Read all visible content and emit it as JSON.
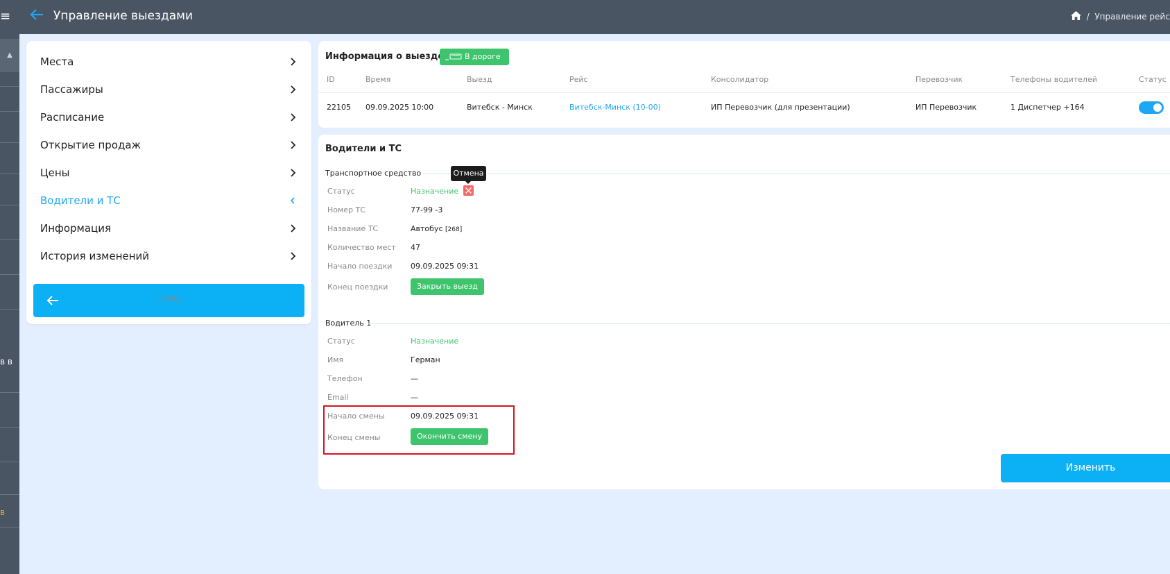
{
  "header": {
    "title": "Управление выездами",
    "breadcrumb": "Управление рейсами"
  },
  "rail": {
    "frag_1": "в в",
    "frag_2": "в"
  },
  "nav": {
    "items": [
      {
        "label": "Места"
      },
      {
        "label": "Пассажиры"
      },
      {
        "label": "Расписание"
      },
      {
        "label": "Открытие продаж"
      },
      {
        "label": "Цены"
      },
      {
        "label": "Водители и ТС",
        "active": true
      },
      {
        "label": "Информация"
      },
      {
        "label": "История изменений"
      }
    ],
    "back_label": "Назад"
  },
  "trip_info": {
    "title": "Информация о выезде",
    "status_badge": "В дороге",
    "columns": [
      "ID",
      "Время",
      "Выезд",
      "Рейс",
      "Консолидатор",
      "Перевозчик",
      "Телефоны водителей",
      "Статус"
    ],
    "row": {
      "id": "22105",
      "time": "09.09.2025 10:00",
      "departure": "Витебск - Минск",
      "route": "Витебск-Минск (10-00)",
      "consolidator": "ИП Перевозчик (для презентации)",
      "carrier": "ИП Перевозчик",
      "phones": "1 Диспетчер +164",
      "status_on": true
    }
  },
  "drivers": {
    "title": "Водители и ТС",
    "vehicle": {
      "section_title": "Транспортное средство",
      "tooltip": "Отмена",
      "labels": {
        "status": "Статус",
        "number": "Номер ТС",
        "name": "Название ТС",
        "seats": "Количество мест",
        "start": "Начало поездки",
        "end": "Конец поездки"
      },
      "values": {
        "status": "Назначение",
        "number": "77-99 -3",
        "name": "Автобус",
        "name_code": "[268]",
        "seats": "47",
        "start": "09.09.2025 09:31",
        "close_button": "Закрыть выезд"
      }
    },
    "driver1": {
      "section_title": "Водитель 1",
      "labels": {
        "status": "Статус",
        "name": "Имя",
        "phone": "Телефон",
        "email": "Email",
        "shift_start": "Начало смены",
        "shift_end": "Конец смены"
      },
      "values": {
        "status": "Назначение",
        "name": "Герман",
        "phone": "—",
        "email": "—",
        "shift_start": "09.09.2025 09:31",
        "end_shift_button": "Окончить смену"
      }
    },
    "edit_button": "Изменить"
  },
  "colors": {
    "header_bg": "#4a5563",
    "accent": "#0cb0f5",
    "link": "#1ea7f2",
    "success": "#3ec46d",
    "danger": "#f06a6a",
    "highlight": "#d6141e",
    "page_bg": "#e3efff"
  }
}
